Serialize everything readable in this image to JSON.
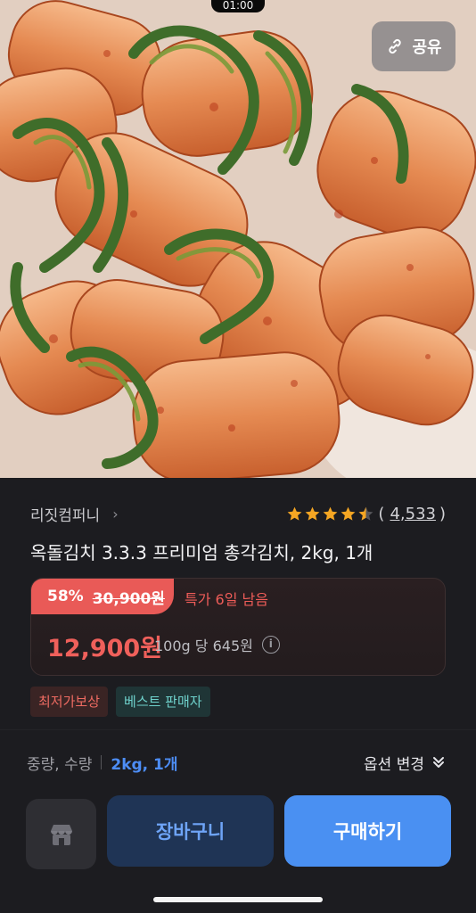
{
  "status": {
    "time": "01:00"
  },
  "hero": {
    "share_label": "공유"
  },
  "product": {
    "seller": "리짓컴퍼니",
    "rating": 4.5,
    "review_count": "4,533",
    "title": "옥돌김치 3.3.3 프리미엄 총각김치, 2kg, 1개"
  },
  "price": {
    "discount": "58%",
    "original": "30,900원",
    "special_note": "특가 6일 남음",
    "sale": "12,900원",
    "unit": "100g 당 645원"
  },
  "badges": {
    "lowest": "최저가보상",
    "best": "베스트 판매자"
  },
  "option": {
    "label": "중량, 수량",
    "value": "2kg, 1개",
    "change": "옵션 변경"
  },
  "actions": {
    "cart": "장바구니",
    "buy": "구매하기"
  },
  "colors": {
    "accent_blue": "#4a90f2",
    "sale_red": "#e95a57",
    "star": "#f5a623"
  }
}
